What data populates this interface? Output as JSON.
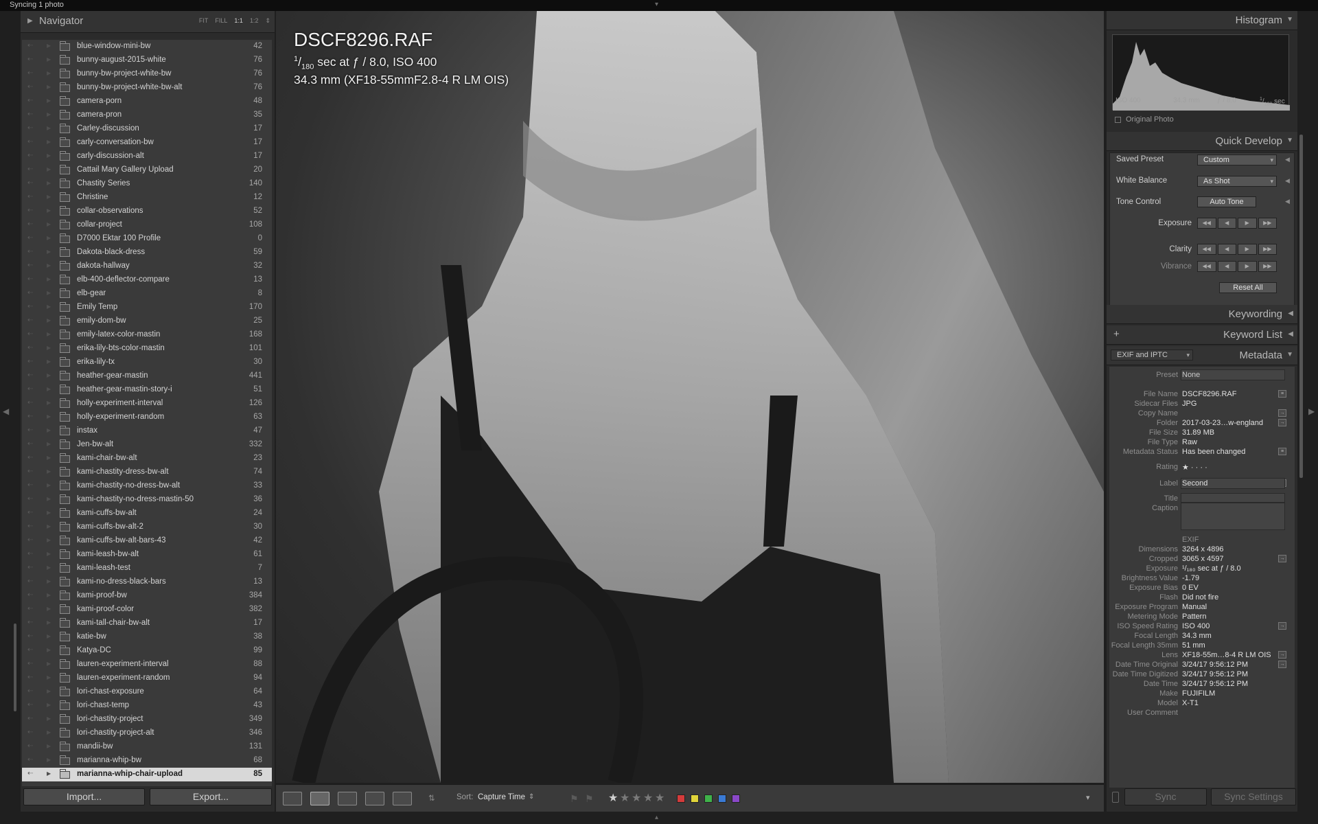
{
  "top": {
    "status": "Syncing 1 photo"
  },
  "navigator": {
    "title": "Navigator",
    "zoom_options": [
      "FIT",
      "FILL",
      "1:1",
      "1:2"
    ]
  },
  "folders": [
    {
      "name": "blue-window-mini-bw",
      "count": "42"
    },
    {
      "name": "bunny-august-2015-white",
      "count": "76"
    },
    {
      "name": "bunny-bw-project-white-bw",
      "count": "76"
    },
    {
      "name": "bunny-bw-project-white-bw-alt",
      "count": "76"
    },
    {
      "name": "camera-porn",
      "count": "48"
    },
    {
      "name": "camera-pron",
      "count": "35"
    },
    {
      "name": "Carley-discussion",
      "count": "17"
    },
    {
      "name": "carly-conversation-bw",
      "count": "17"
    },
    {
      "name": "carly-discussion-alt",
      "count": "17"
    },
    {
      "name": "Cattail Mary Gallery Upload",
      "count": "20"
    },
    {
      "name": "Chastity Series",
      "count": "140"
    },
    {
      "name": "Christine",
      "count": "12"
    },
    {
      "name": "collar-observations",
      "count": "52"
    },
    {
      "name": "collar-project",
      "count": "108"
    },
    {
      "name": "D7000 Ektar 100 Profile",
      "count": "0"
    },
    {
      "name": "Dakota-black-dress",
      "count": "59"
    },
    {
      "name": "dakota-hallway",
      "count": "32"
    },
    {
      "name": "elb-400-deflector-compare",
      "count": "13"
    },
    {
      "name": "elb-gear",
      "count": "8"
    },
    {
      "name": "Emily Temp",
      "count": "170"
    },
    {
      "name": "emily-dom-bw",
      "count": "25"
    },
    {
      "name": "emily-latex-color-mastin",
      "count": "168"
    },
    {
      "name": "erika-lily-bts-color-mastin",
      "count": "101"
    },
    {
      "name": "erika-lily-tx",
      "count": "30"
    },
    {
      "name": "heather-gear-mastin",
      "count": "441"
    },
    {
      "name": "heather-gear-mastin-story-i",
      "count": "51"
    },
    {
      "name": "holly-experiment-interval",
      "count": "126"
    },
    {
      "name": "holly-experiment-random",
      "count": "63"
    },
    {
      "name": "instax",
      "count": "47"
    },
    {
      "name": "Jen-bw-alt",
      "count": "332"
    },
    {
      "name": "kami-chair-bw-alt",
      "count": "23"
    },
    {
      "name": "kami-chastity-dress-bw-alt",
      "count": "74"
    },
    {
      "name": "kami-chastity-no-dress-bw-alt",
      "count": "33"
    },
    {
      "name": "kami-chastity-no-dress-mastin-50",
      "count": "36"
    },
    {
      "name": "kami-cuffs-bw-alt",
      "count": "24"
    },
    {
      "name": "kami-cuffs-bw-alt-2",
      "count": "30"
    },
    {
      "name": "kami-cuffs-bw-alt-bars-43",
      "count": "42"
    },
    {
      "name": "kami-leash-bw-alt",
      "count": "61"
    },
    {
      "name": "kami-leash-test",
      "count": "7"
    },
    {
      "name": "kami-no-dress-black-bars",
      "count": "13"
    },
    {
      "name": "kami-proof-bw",
      "count": "384"
    },
    {
      "name": "kami-proof-color",
      "count": "382"
    },
    {
      "name": "kami-tall-chair-bw-alt",
      "count": "17"
    },
    {
      "name": "katie-bw",
      "count": "38"
    },
    {
      "name": "Katya-DC",
      "count": "99"
    },
    {
      "name": "lauren-experiment-interval",
      "count": "88"
    },
    {
      "name": "lauren-experiment-random",
      "count": "94"
    },
    {
      "name": "lori-chast-exposure",
      "count": "64"
    },
    {
      "name": "lori-chast-temp",
      "count": "43"
    },
    {
      "name": "lori-chastity-project",
      "count": "349"
    },
    {
      "name": "lori-chastity-project-alt",
      "count": "346"
    },
    {
      "name": "mandii-bw",
      "count": "131"
    },
    {
      "name": "marianna-whip-bw",
      "count": "68"
    },
    {
      "name": "marianna-whip-chair-upload",
      "count": "85"
    }
  ],
  "left_buttons": {
    "import": "Import...",
    "export": "Export..."
  },
  "photo": {
    "filename": "DSCF8296.RAF",
    "shutter_num": "1",
    "shutter_den": "180",
    "exposure_rest": "sec at ƒ / 8.0, ISO 400",
    "lens_line": "34.3 mm (XF18-55mmF2.8-4 R LM OIS)"
  },
  "toolbar": {
    "sort_label": "Sort:",
    "sort_value": "Capture Time",
    "labels": [
      "#d43b3b",
      "#e0d43a",
      "#3fb24a",
      "#3a7ad4",
      "#8a48c8"
    ]
  },
  "histogram": {
    "title": "Histogram",
    "iso": "ISO 400",
    "focal": "34.3 mm",
    "aperture": "ƒ / 8.0",
    "shutter_num": "1",
    "shutter_den": "180",
    "shutter_unit": "sec",
    "original_photo": "Original Photo"
  },
  "quick_develop": {
    "title": "Quick Develop",
    "saved_preset_label": "Saved Preset",
    "saved_preset_value": "Custom",
    "white_balance_label": "White Balance",
    "white_balance_value": "As Shot",
    "tone_control_label": "Tone Control",
    "auto_tone": "Auto Tone",
    "exposure_label": "Exposure",
    "clarity_label": "Clarity",
    "vibrance_label": "Vibrance",
    "reset_all": "Reset All"
  },
  "keywording": {
    "title": "Keywording"
  },
  "keyword_list": {
    "title": "Keyword List",
    "add": "+"
  },
  "metadata": {
    "title": "Metadata",
    "view_mode": "EXIF and IPTC",
    "preset_label": "Preset",
    "preset_value": "None",
    "rows": [
      {
        "k": "File Name",
        "v": "DSCF8296.RAF"
      },
      {
        "k": "Sidecar Files",
        "v": "JPG"
      },
      {
        "k": "Copy Name",
        "v": ""
      },
      {
        "k": "Folder",
        "v": "2017-03-23…w-england"
      },
      {
        "k": "File Size",
        "v": "31.89 MB"
      },
      {
        "k": "File Type",
        "v": "Raw"
      },
      {
        "k": "Metadata Status",
        "v": "Has been changed"
      }
    ],
    "rating_label": "Rating",
    "rating_value": "★ · · · ·",
    "label_label": "Label",
    "label_value": "Second",
    "title_label": "Title",
    "caption_label": "Caption",
    "exif_heading": "EXIF",
    "exif_rows": [
      {
        "k": "Dimensions",
        "v": "3264 x 4896"
      },
      {
        "k": "Cropped",
        "v": "3065 x 4597"
      },
      {
        "k": "Exposure",
        "v": "¹/₁₈₀ sec at ƒ / 8.0"
      },
      {
        "k": "Brightness Value",
        "v": "-1.79"
      },
      {
        "k": "Exposure Bias",
        "v": "0 EV"
      },
      {
        "k": "Flash",
        "v": "Did not fire"
      },
      {
        "k": "Exposure Program",
        "v": "Manual"
      },
      {
        "k": "Metering Mode",
        "v": "Pattern"
      },
      {
        "k": "ISO Speed Rating",
        "v": "ISO 400"
      },
      {
        "k": "Focal Length",
        "v": "34.3 mm"
      },
      {
        "k": "Focal Length 35mm",
        "v": "51 mm"
      },
      {
        "k": "Lens",
        "v": "XF18-55m…8-4 R LM OIS"
      },
      {
        "k": "Date Time Original",
        "v": "3/24/17 9:56:12 PM"
      },
      {
        "k": "Date Time Digitized",
        "v": "3/24/17 9:56:12 PM"
      },
      {
        "k": "Date Time",
        "v": "3/24/17 9:56:12 PM"
      },
      {
        "k": "Make",
        "v": "FUJIFILM"
      },
      {
        "k": "Model",
        "v": "X-T1"
      },
      {
        "k": "User Comment",
        "v": ""
      }
    ]
  },
  "sync": {
    "sync": "Sync",
    "sync_settings": "Sync Settings"
  }
}
